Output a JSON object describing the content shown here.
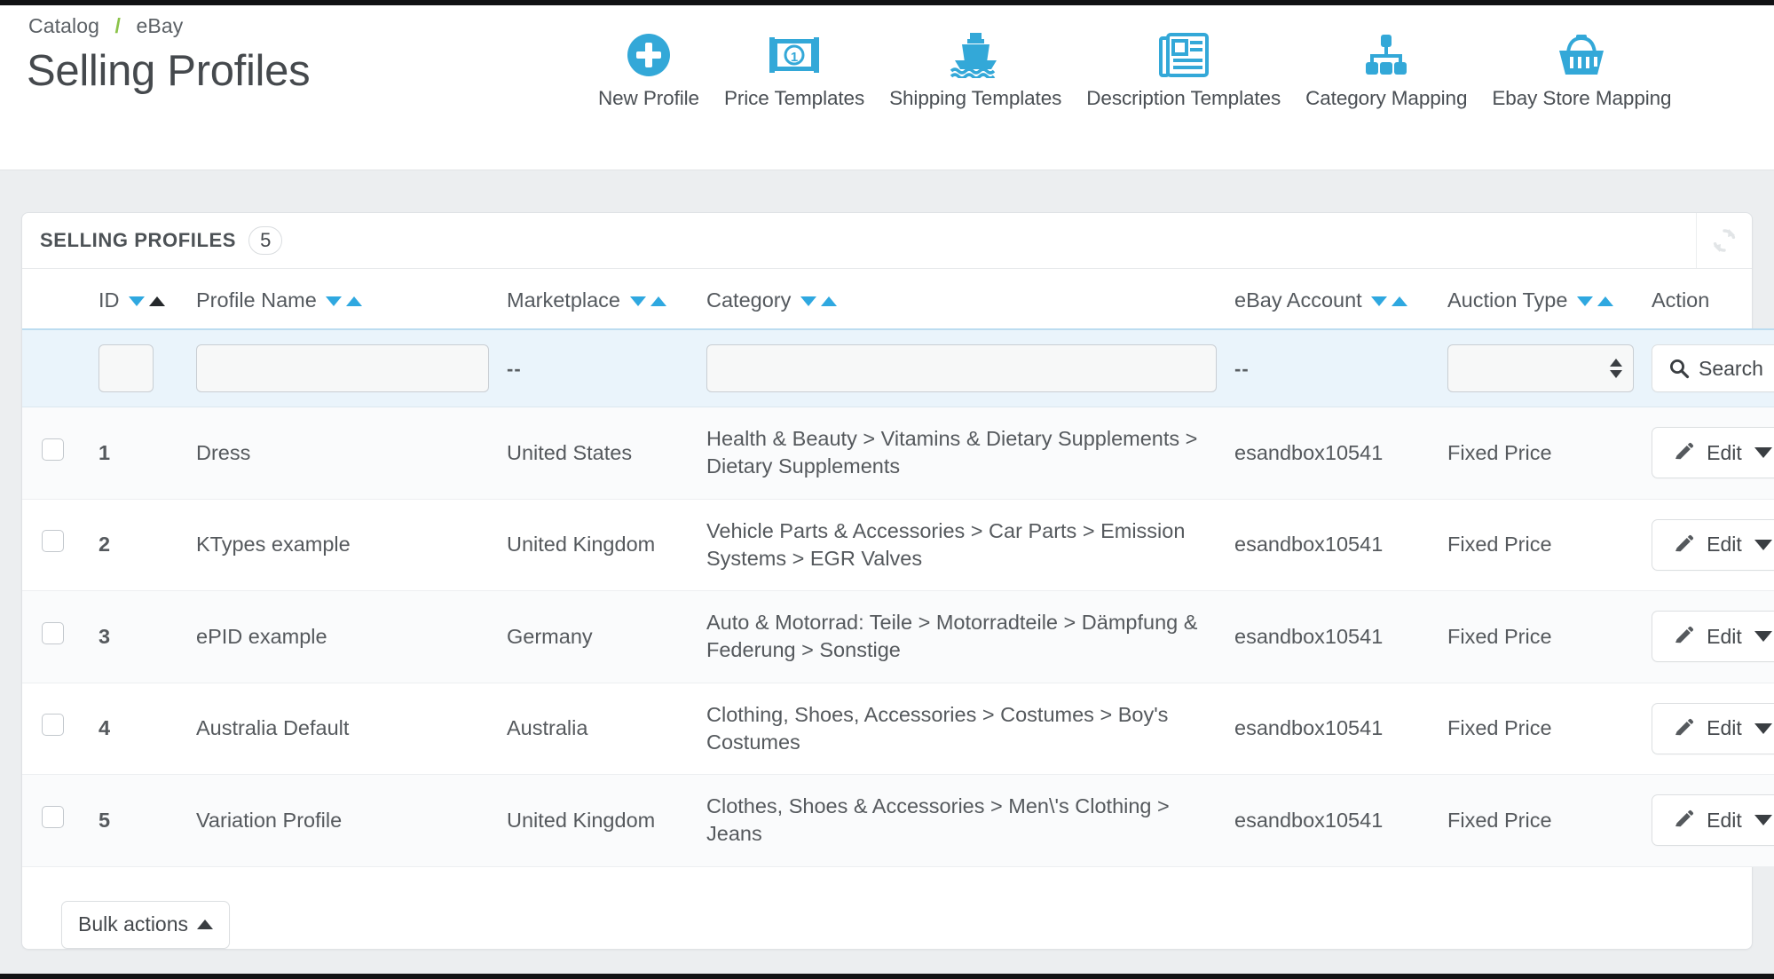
{
  "breadcrumb": {
    "items": [
      "Catalog",
      "eBay"
    ],
    "separator": "/"
  },
  "header": {
    "title": "Selling Profiles"
  },
  "toolbar": {
    "items": [
      {
        "label": "New Profile",
        "icon": "plus-circle-icon"
      },
      {
        "label": "Price Templates",
        "icon": "banknote-icon"
      },
      {
        "label": "Shipping Templates",
        "icon": "ship-icon"
      },
      {
        "label": "Description Templates",
        "icon": "newspaper-icon"
      },
      {
        "label": "Category Mapping",
        "icon": "sitemap-icon"
      },
      {
        "label": "Ebay Store Mapping",
        "icon": "basket-icon"
      }
    ]
  },
  "panel": {
    "title": "SELLING PROFILES",
    "count": "5",
    "refresh_icon": "refresh-icon"
  },
  "table": {
    "columns": [
      {
        "key": "check",
        "label": ""
      },
      {
        "key": "id",
        "label": "ID"
      },
      {
        "key": "name",
        "label": "Profile Name"
      },
      {
        "key": "market",
        "label": "Marketplace"
      },
      {
        "key": "cat",
        "label": "Category"
      },
      {
        "key": "acct",
        "label": "eBay Account"
      },
      {
        "key": "auc",
        "label": "Auction Type"
      },
      {
        "key": "act",
        "label": "Action"
      }
    ],
    "sort": {
      "active_column": "ID",
      "active_direction": "asc"
    },
    "filters": {
      "id_value": "",
      "id_placeholder": "",
      "name_value": "",
      "name_placeholder": "",
      "marketplace_value": "--",
      "category_value": "",
      "category_placeholder": "",
      "account_value": "--",
      "auction_type_value": "",
      "search_label": "Search",
      "search_icon": "search-icon"
    },
    "rows": [
      {
        "id": "1",
        "name": "Dress",
        "marketplace": "United States",
        "category": "Health & Beauty > Vitamins & Dietary Supplements > Dietary Supplements",
        "account": "esandbox10541",
        "auction_type": "Fixed Price",
        "action_label": "Edit",
        "action_icon": "pencil-icon"
      },
      {
        "id": "2",
        "name": "KTypes example",
        "marketplace": "United Kingdom",
        "category": "Vehicle Parts & Accessories > Car Parts > Emission Systems > EGR Valves",
        "account": "esandbox10541",
        "auction_type": "Fixed Price",
        "action_label": "Edit",
        "action_icon": "pencil-icon"
      },
      {
        "id": "3",
        "name": "ePID example",
        "marketplace": "Germany",
        "category": "Auto & Motorrad: Teile > Motorradteile > Dämpfung & Federung > Sonstige",
        "account": "esandbox10541",
        "auction_type": "Fixed Price",
        "action_label": "Edit",
        "action_icon": "pencil-icon"
      },
      {
        "id": "4",
        "name": "Australia Default",
        "marketplace": "Australia",
        "category": "Clothing, Shoes, Accessories > Costumes > Boy's Costumes",
        "account": "esandbox10541",
        "auction_type": "Fixed Price",
        "action_label": "Edit",
        "action_icon": "pencil-icon"
      },
      {
        "id": "5",
        "name": "Variation Profile",
        "marketplace": "United Kingdom",
        "category": "Clothes, Shoes & Accessories > Men\\'s Clothing > Jeans",
        "account": "esandbox10541",
        "auction_type": "Fixed Price",
        "action_label": "Edit",
        "action_icon": "pencil-icon"
      }
    ]
  },
  "footer": {
    "bulk_actions_label": "Bulk actions"
  },
  "colors": {
    "accent": "#2fa8e0",
    "breadcrumb_separator": "#8bc34a",
    "filter_row_bg": "#eaf4fb",
    "page_bg": "#eceef0",
    "text": "#55595d"
  }
}
